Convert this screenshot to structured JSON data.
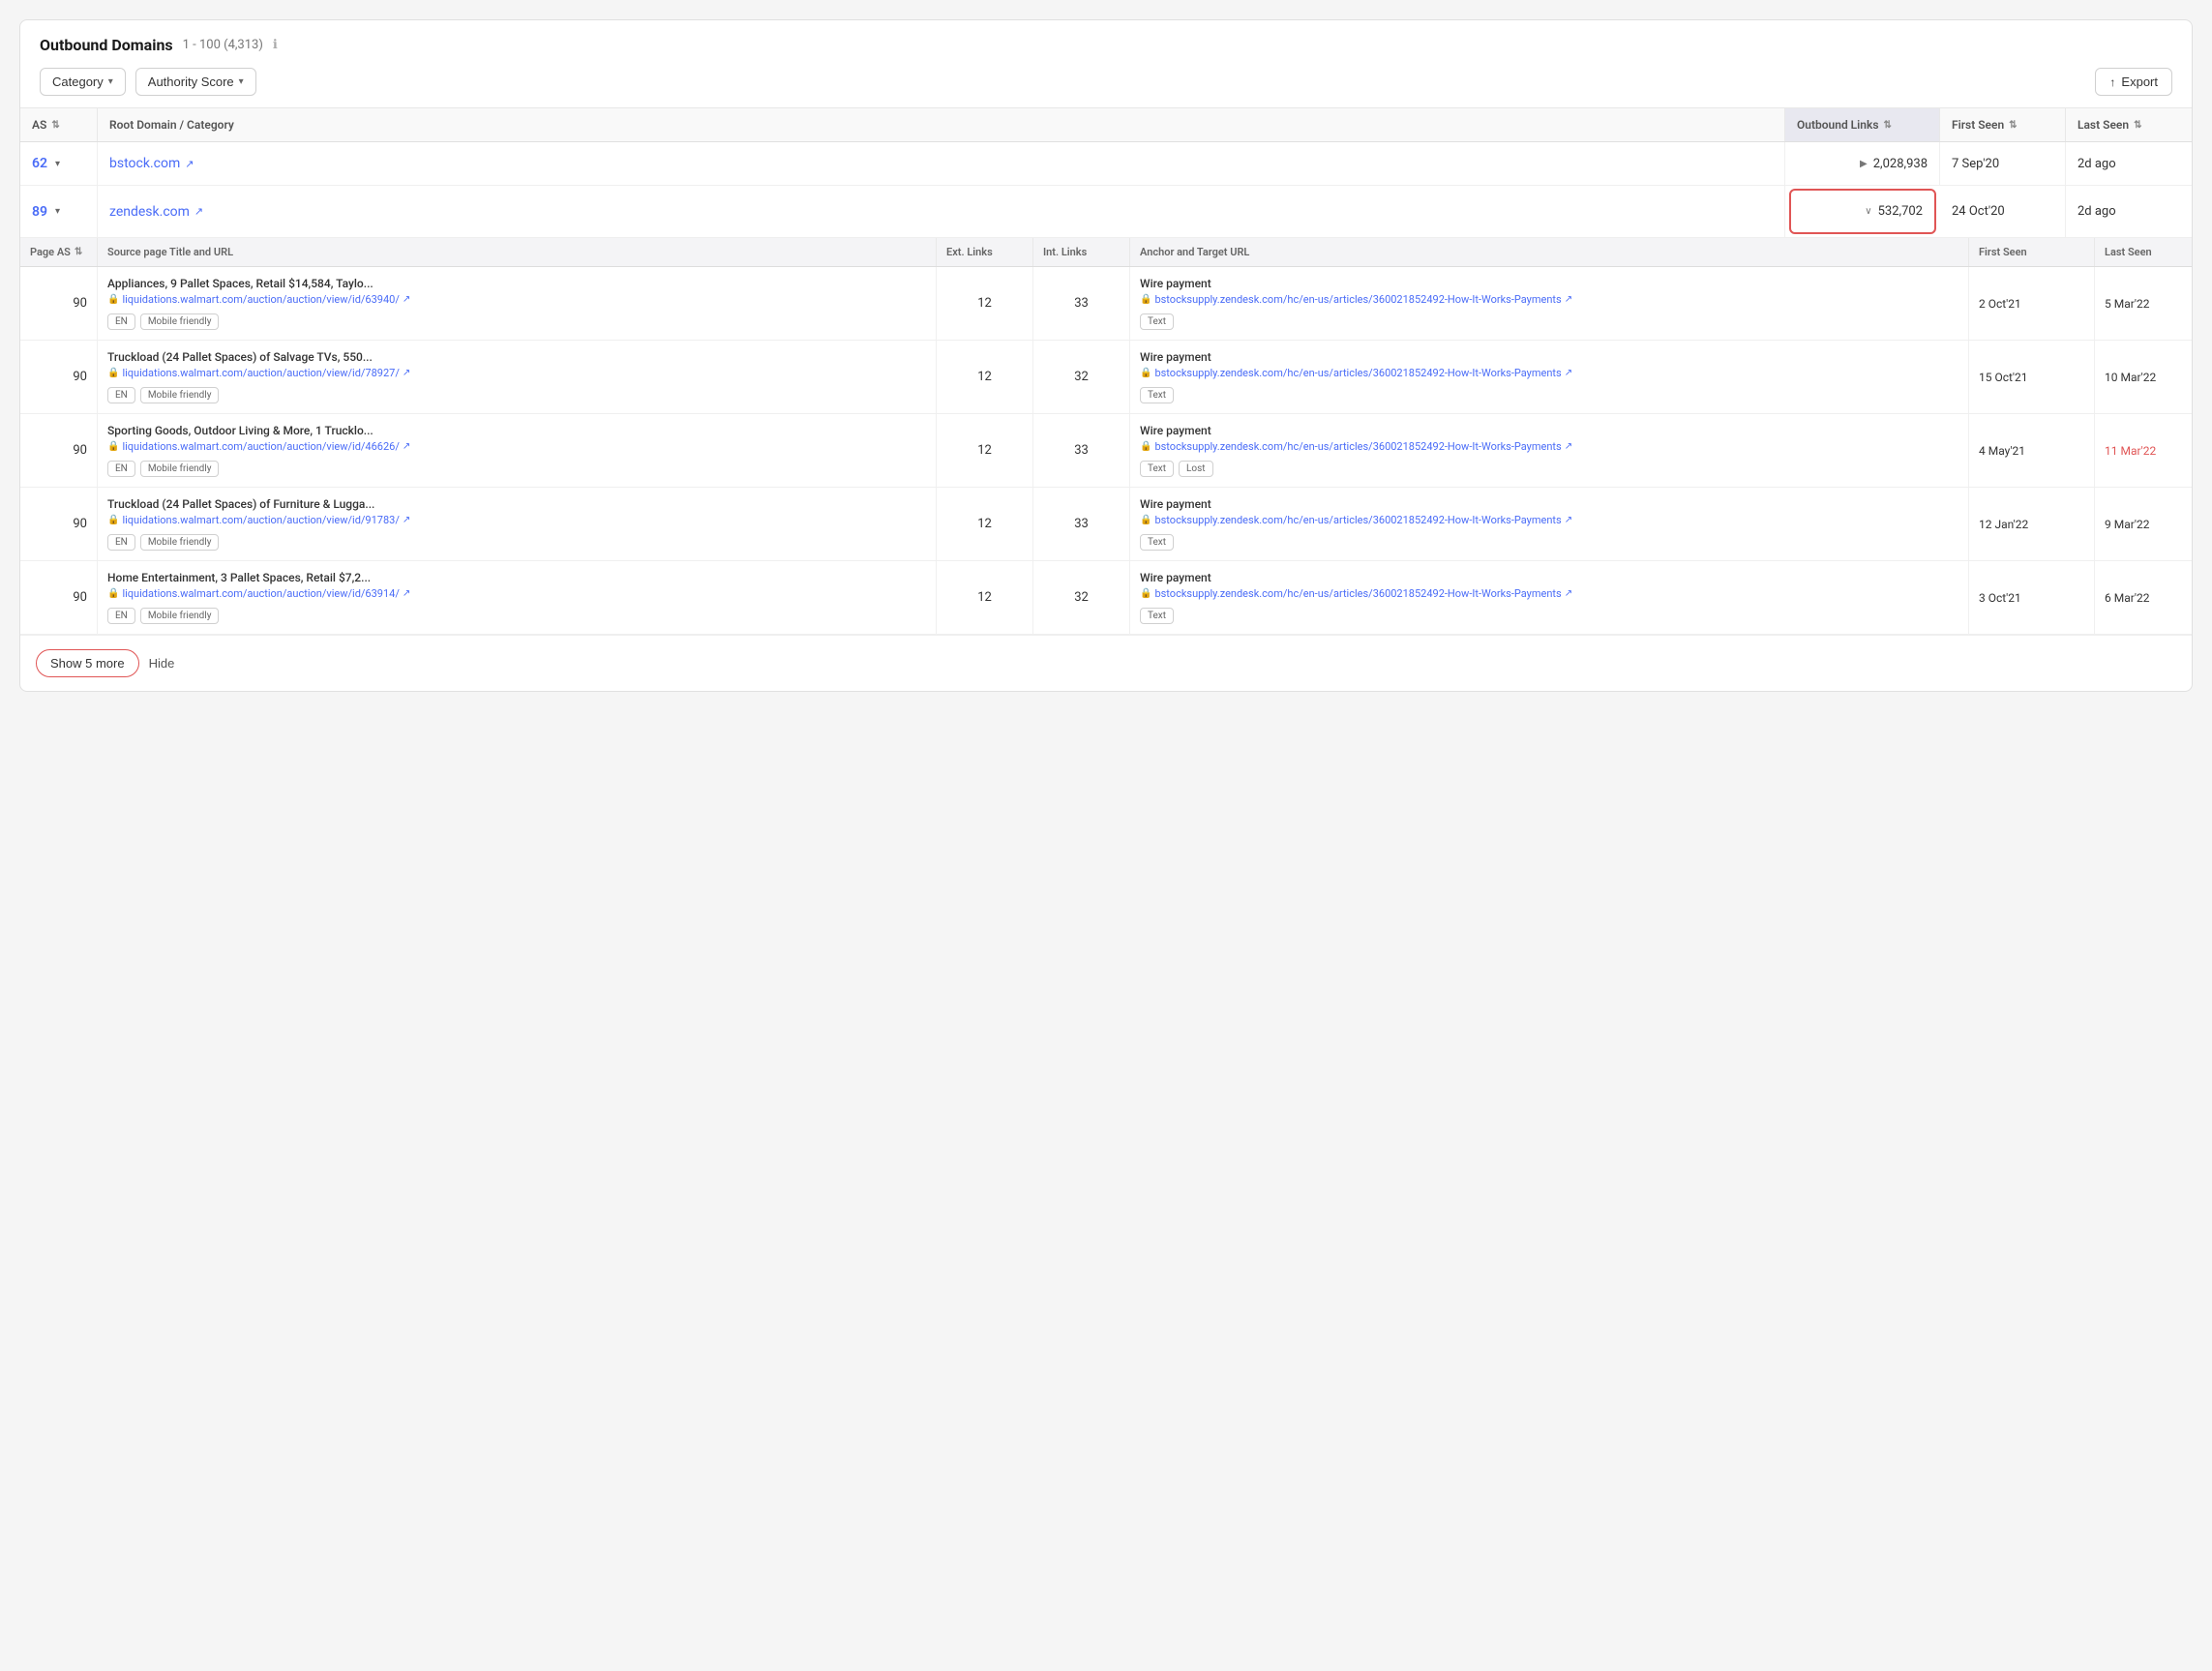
{
  "page": {
    "title": "Outbound Domains",
    "range": "1 - 100 (4,313)",
    "info_icon": "ℹ"
  },
  "filters": {
    "category_label": "Category",
    "authority_score_label": "Authority Score",
    "export_label": "Export"
  },
  "main_columns": [
    {
      "id": "as",
      "label": "AS",
      "sortable": true
    },
    {
      "id": "root_domain",
      "label": "Root Domain / Category",
      "sortable": false
    },
    {
      "id": "outbound_links",
      "label": "Outbound Links",
      "sortable": true,
      "active": true
    },
    {
      "id": "first_seen",
      "label": "First Seen",
      "sortable": true
    },
    {
      "id": "last_seen",
      "label": "Last Seen",
      "sortable": true
    }
  ],
  "domain_rows": [
    {
      "score": "62",
      "domain": "bstock.com",
      "outbound_links": "2,028,938",
      "outbound_links_prefix": "▶",
      "first_seen": "7 Sep'20",
      "last_seen": "2d ago",
      "highlighted": false
    },
    {
      "score": "89",
      "domain": "zendesk.com",
      "outbound_links": "532,702",
      "outbound_links_prefix": "∨",
      "first_seen": "24 Oct'20",
      "last_seen": "2d ago",
      "highlighted": true
    }
  ],
  "sub_columns": [
    {
      "id": "page_as",
      "label": "Page AS",
      "sortable": true
    },
    {
      "id": "source_title_url",
      "label": "Source page Title and URL",
      "sortable": false
    },
    {
      "id": "ext_links",
      "label": "Ext. Links",
      "sortable": false
    },
    {
      "id": "int_links",
      "label": "Int. Links",
      "sortable": false
    },
    {
      "id": "anchor_target",
      "label": "Anchor and Target URL",
      "sortable": false
    },
    {
      "id": "first_seen",
      "label": "First Seen",
      "sortable": false
    },
    {
      "id": "last_seen",
      "label": "Last Seen",
      "sortable": false
    }
  ],
  "sub_rows": [
    {
      "page_as": "90",
      "title": "Appliances, 9 Pallet Spaces, Retail $14,584, Taylo...",
      "url": "liquidations.walmart.com/auction/auction/view/id/63940/",
      "ext_links": "12",
      "int_links": "33",
      "anchor_text": "Wire payment",
      "anchor_url": "bstocksupply.zendesk.com/hc/en-us/articles/360021852492-How-It-Works-Payments",
      "tags": [
        "EN",
        "Mobile friendly"
      ],
      "link_tags": [
        "Text"
      ],
      "first_seen": "2 Oct'21",
      "last_seen": "5 Mar'22",
      "last_seen_red": false
    },
    {
      "page_as": "90",
      "title": "Truckload (24 Pallet Spaces) of Salvage TVs, 550...",
      "url": "liquidations.walmart.com/auction/auction/view/id/78927/",
      "ext_links": "12",
      "int_links": "32",
      "anchor_text": "Wire payment",
      "anchor_url": "bstocksupply.zendesk.com/hc/en-us/articles/360021852492-How-It-Works-Payments",
      "tags": [
        "EN",
        "Mobile friendly"
      ],
      "link_tags": [
        "Text"
      ],
      "first_seen": "15 Oct'21",
      "last_seen": "10 Mar'22",
      "last_seen_red": false
    },
    {
      "page_as": "90",
      "title": "Sporting Goods, Outdoor Living & More, 1 Trucklo...",
      "url": "liquidations.walmart.com/auction/auction/view/id/46626/",
      "ext_links": "12",
      "int_links": "33",
      "anchor_text": "Wire payment",
      "anchor_url": "bstocksupply.zendesk.com/hc/en-us/articles/360021852492-How-It-Works-Payments",
      "tags": [
        "EN",
        "Mobile friendly"
      ],
      "link_tags": [
        "Text",
        "Lost"
      ],
      "first_seen": "4 May'21",
      "last_seen": "11 Mar'22",
      "last_seen_red": true
    },
    {
      "page_as": "90",
      "title": "Truckload (24 Pallet Spaces) of Furniture & Lugga...",
      "url": "liquidations.walmart.com/auction/auction/view/id/91783/",
      "ext_links": "12",
      "int_links": "33",
      "anchor_text": "Wire payment",
      "anchor_url": "bstocksupply.zendesk.com/hc/en-us/articles/360021852492-How-It-Works-Payments",
      "tags": [
        "EN",
        "Mobile friendly"
      ],
      "link_tags": [
        "Text"
      ],
      "first_seen": "12 Jan'22",
      "last_seen": "9 Mar'22",
      "last_seen_red": false
    },
    {
      "page_as": "90",
      "title": "Home Entertainment, 3 Pallet Spaces, Retail $7,2...",
      "url": "liquidations.walmart.com/auction/auction/view/id/63914/",
      "ext_links": "12",
      "int_links": "32",
      "anchor_text": "Wire payment",
      "anchor_url": "bstocksupply.zendesk.com/hc/en-us/articles/360021852492-How-It-Works-Payments",
      "tags": [
        "EN",
        "Mobile friendly"
      ],
      "link_tags": [
        "Text"
      ],
      "first_seen": "3 Oct'21",
      "last_seen": "6 Mar'22",
      "last_seen_red": false
    }
  ],
  "footer": {
    "show_more_label": "Show 5 more",
    "hide_label": "Hide"
  }
}
